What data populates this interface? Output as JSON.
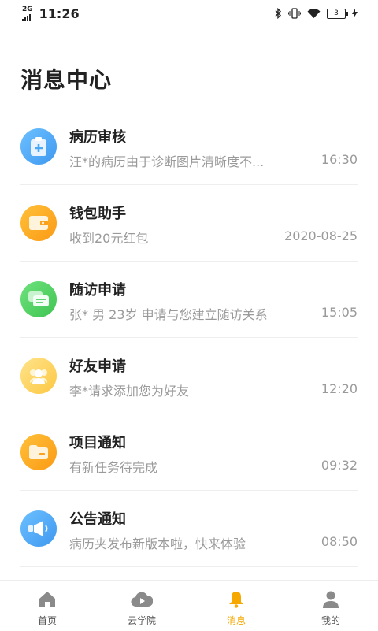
{
  "status_bar": {
    "network": "2G",
    "time": "11:26",
    "battery": "3"
  },
  "page": {
    "title": "消息中心"
  },
  "messages": [
    {
      "title": "病历审核",
      "preview": "汪*的病历由于诊断图片清晰度不...",
      "time": "16:30",
      "icon": "medical-record-icon",
      "color": "#4aa8f5"
    },
    {
      "title": "钱包助手",
      "preview": "收到20元红包",
      "time": "2020-08-25",
      "icon": "wallet-icon",
      "color": "#fca11c"
    },
    {
      "title": "随访申请",
      "preview": "张*  男  23岁  申请与您建立随访关系",
      "time": "15:05",
      "icon": "chat-icon",
      "color": "#4fcf61"
    },
    {
      "title": "好友申请",
      "preview": "李*请求添加您为好友",
      "time": "12:20",
      "icon": "friends-icon",
      "color": "#fdd35f"
    },
    {
      "title": "项目通知",
      "preview": "有新任务待完成",
      "time": "09:32",
      "icon": "folder-icon",
      "color": "#fca11c"
    },
    {
      "title": "公告通知",
      "preview": "病历夹发布新版本啦，快来体验",
      "time": "08:50",
      "icon": "megaphone-icon",
      "color": "#4aa8f5"
    }
  ],
  "nav": {
    "items": [
      {
        "label": "首页",
        "icon": "home-icon"
      },
      {
        "label": "云学院",
        "icon": "cloud-play-icon"
      },
      {
        "label": "消息",
        "icon": "bell-icon",
        "active": true
      },
      {
        "label": "我的",
        "icon": "person-icon"
      }
    ],
    "active_color": "#f6a800",
    "inactive_color": "#8a8a8a"
  }
}
